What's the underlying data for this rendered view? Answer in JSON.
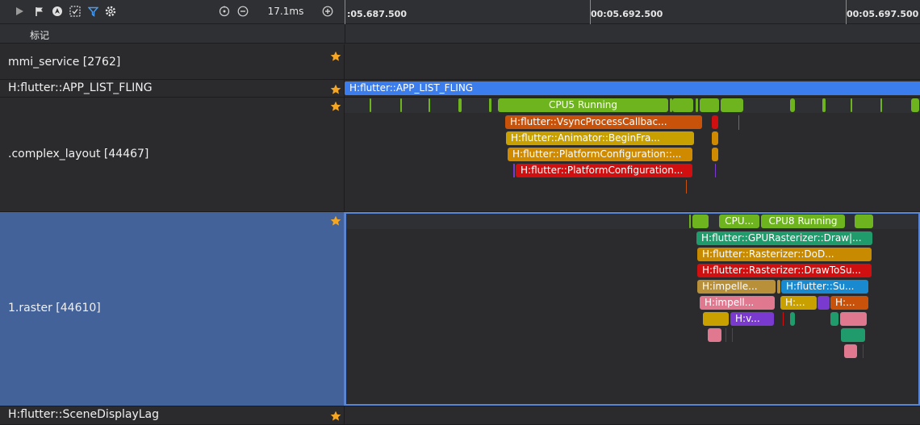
{
  "toolbar": {
    "icons": [
      "play-icon",
      "flag-icon",
      "navigate-icon",
      "sync-icon",
      "filter-icon",
      "settings-icon",
      "reset-zoom-icon",
      "zoom-out-icon",
      "zoom-in-icon"
    ],
    "duration": "17.1ms"
  },
  "ruler": {
    "labels": [
      ":05.687.500",
      "00:05.692.500",
      "00:05.697.500"
    ]
  },
  "marker_row": {
    "label": "标记"
  },
  "lanes": {
    "mmi": {
      "title": "mmi_service [2762]"
    },
    "fling": {
      "title": "H:flutter::APP_LIST_FLING",
      "slice_label": "H:flutter::APP_LIST_FLING"
    },
    "complex": {
      "title": ".complex_layout [44467]",
      "cpu_label": "CPU5 Running",
      "slices": [
        "H:flutter::VsyncProcessCallbac...",
        "H:flutter::Animator::BeginFra...",
        "H:flutter::PlatformConfiguration::...",
        "H:flutter::PlatformConfiguration..."
      ]
    },
    "raster": {
      "title": "1.raster [44610]",
      "cpu_labels": [
        "CPU...",
        "CPU8 Running"
      ],
      "slices": [
        "H:flutter::GPURasterizer::Draw|...",
        "H:flutter::Rasterizer::DoD...",
        "H:flutter::Rasterizer::DrawToSu...",
        "H:impelle...",
        "H:flutter::Su...",
        "H:impell...",
        "H:...",
        "H:...",
        "H:v..."
      ]
    },
    "scene": {
      "title": "H:flutter::SceneDisplayLag"
    }
  },
  "colors": {
    "accent_blue": "#3b7ded",
    "cpu_green": "#6db41f",
    "star": "#f5a623",
    "selected_lane": "#44629a"
  }
}
